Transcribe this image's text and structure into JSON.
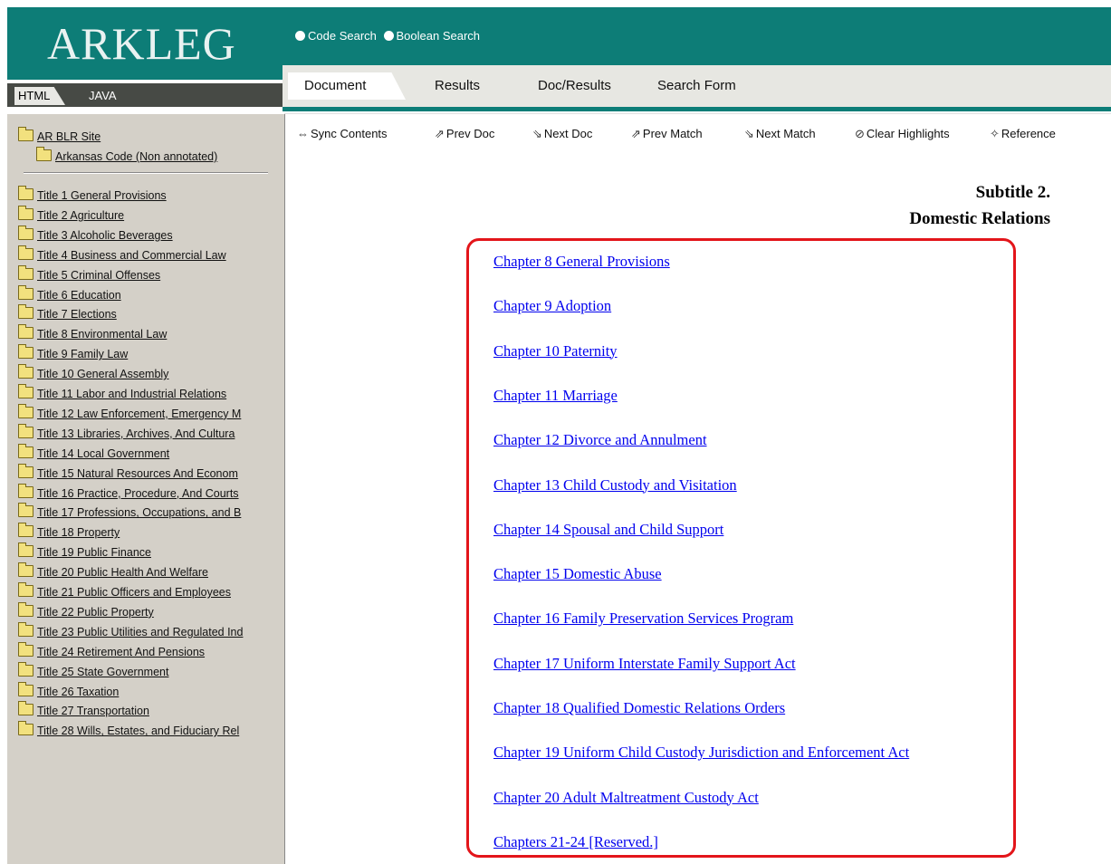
{
  "header": {
    "logo": "ARKLEG",
    "view_tabs": [
      "HTML",
      "JAVA"
    ],
    "search_modes": [
      "Code Search",
      "Boolean Search"
    ],
    "doc_tabs": [
      "Document",
      "Results",
      "Doc/Results",
      "Search Form"
    ]
  },
  "toolbar": [
    "Sync Contents",
    "Prev Doc",
    "Next Doc",
    "Prev Match",
    "Next Match",
    "Clear Highlights",
    "Reference"
  ],
  "sidebar": {
    "root": "AR BLR Site",
    "sub": "Arkansas Code (Non annotated)",
    "titles": [
      "Title 1 General Provisions",
      "Title 2 Agriculture",
      "Title 3 Alcoholic Beverages",
      "Title 4 Business and Commercial Law",
      "Title 5 Criminal Offenses",
      "Title 6 Education",
      "Title 7 Elections",
      "Title 8 Environmental Law",
      "Title 9 Family Law",
      "Title 10 General Assembly",
      "Title 11 Labor and Industrial Relations",
      "Title 12 Law Enforcement, Emergency M",
      "Title 13 Libraries, Archives, And Cultura",
      "Title 14 Local Government",
      "Title 15 Natural Resources And Econom",
      "Title 16 Practice, Procedure, And Courts",
      "Title 17 Professions, Occupations, and B",
      "Title 18 Property",
      "Title 19 Public Finance",
      "Title 20 Public Health And Welfare",
      "Title 21 Public Officers and Employees",
      "Title 22 Public Property",
      "Title 23 Public Utilities and Regulated Ind",
      "Title 24 Retirement And Pensions",
      "Title 25 State Government",
      "Title 26 Taxation",
      "Title 27 Transportation",
      "Title 28 Wills, Estates, and Fiduciary Rel"
    ]
  },
  "content": {
    "subtitle_line1": "Subtitle 2.",
    "subtitle_line2": "Domestic Relations",
    "chapters": [
      "Chapter 8 General Provisions",
      "Chapter 9 Adoption",
      "Chapter 10 Paternity",
      "Chapter 11 Marriage",
      "Chapter 12 Divorce and Annulment",
      "Chapter 13 Child Custody and Visitation",
      "Chapter 14 Spousal and Child Support",
      "Chapter 15 Domestic Abuse",
      "Chapter 16 Family Preservation Services Program",
      "Chapter 17 Uniform Interstate Family Support Act",
      "Chapter 18 Qualified Domestic Relations Orders",
      "Chapter 19 Uniform Child Custody Jurisdiction and Enforcement Act",
      "Chapter 20 Adult Maltreatment Custody Act",
      "Chapters 21-24 [Reserved.]"
    ]
  },
  "colors": {
    "teal": "#0d7d77",
    "highlight_box": "#e3151a",
    "link": "#0000ee"
  }
}
